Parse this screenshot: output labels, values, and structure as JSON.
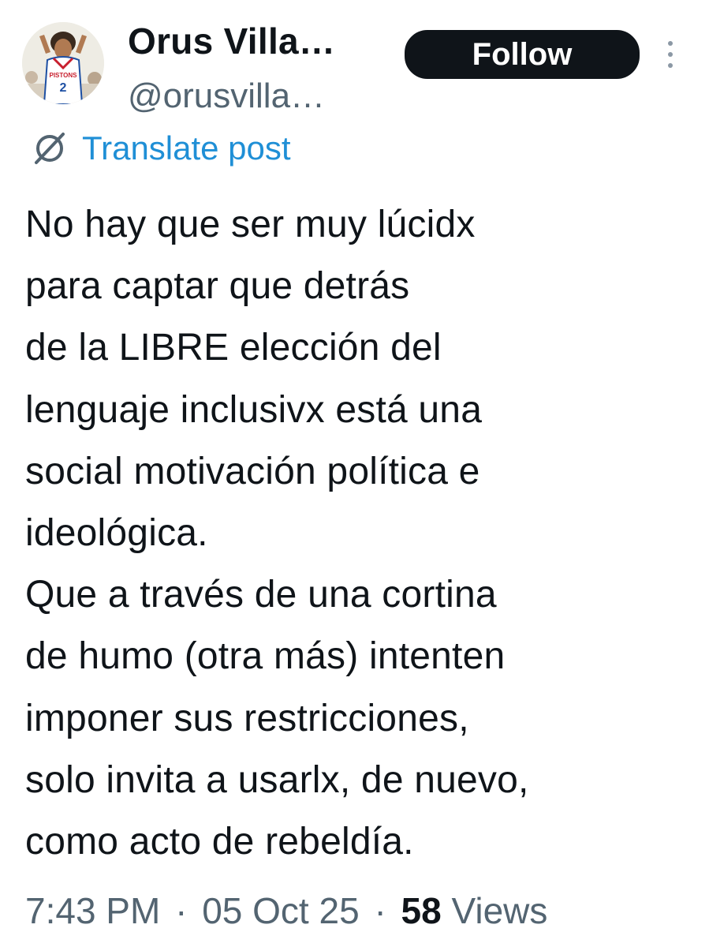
{
  "author": {
    "display_name": "Orus Villa…",
    "handle": "@orusvilla…",
    "avatar_jersey_text": "PISTONS",
    "avatar_jersey_number": "2"
  },
  "actions": {
    "follow_label": "Follow"
  },
  "translate": {
    "label": "Translate post"
  },
  "post": {
    "lines": [
      "No hay que ser muy lúcidx",
      "para captar que detrás",
      "de la LIBRE elección del",
      "lenguaje inclusivx está una",
      "social motivación política e",
      "ideológica.",
      "Que a través de una cortina",
      "de humo (otra más) intenten",
      "imponer sus restricciones,",
      "solo invita a usarlx, de nuevo,",
      "como acto de rebeldía."
    ]
  },
  "meta": {
    "time": "7:43 PM",
    "separator": "·",
    "date": "05 Oct 25",
    "views_count": "58",
    "views_label": "Views"
  },
  "colors": {
    "text": "#0f1419",
    "secondary": "#536471",
    "link": "#1f8fd6",
    "follow_bg": "#0f1419",
    "follow_text": "#ffffff"
  },
  "icons": {
    "more": "more-vertical-icon",
    "translate": "translate-globe-icon"
  }
}
